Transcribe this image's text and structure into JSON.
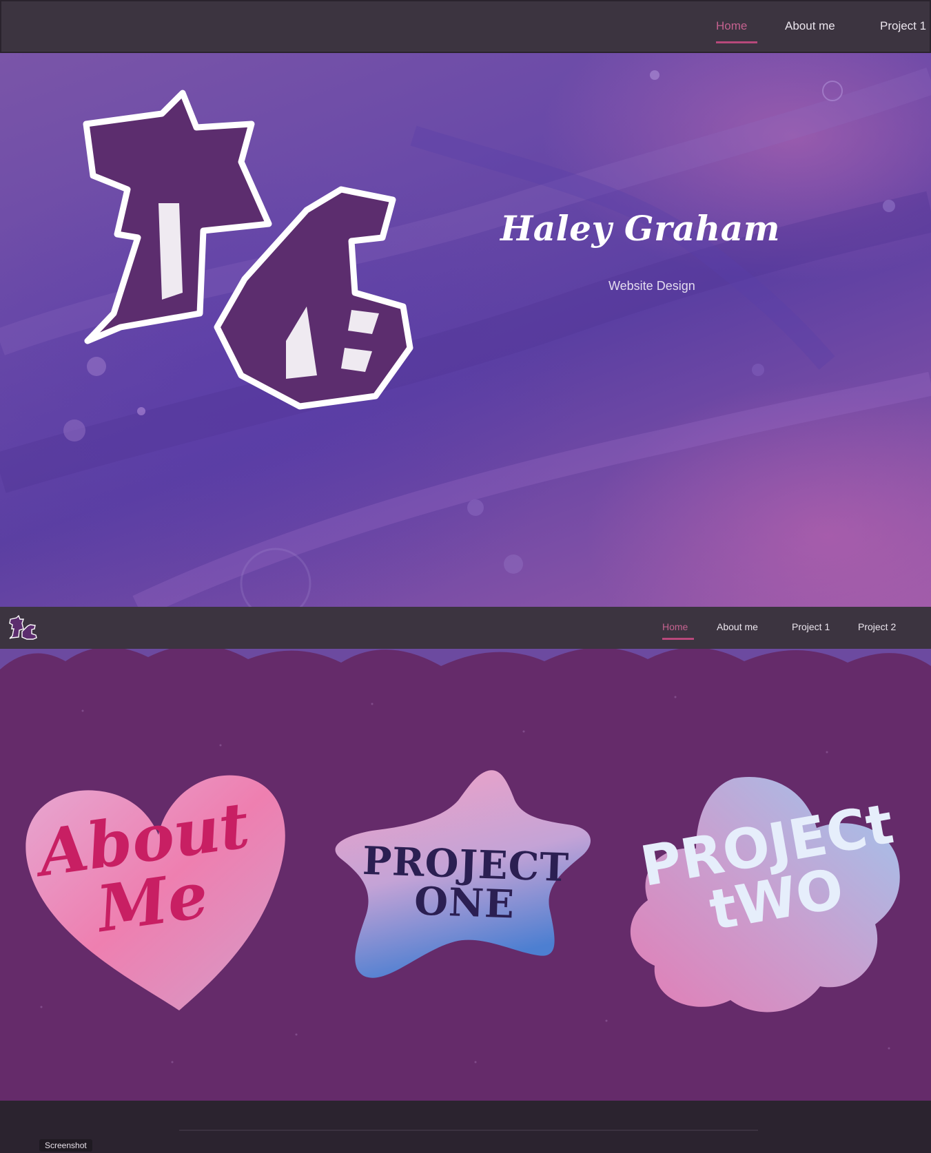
{
  "topnav": {
    "items": [
      {
        "label": "Home",
        "active": true
      },
      {
        "label": "About me",
        "active": false
      },
      {
        "label": "Project 1",
        "active": false
      }
    ]
  },
  "hero": {
    "title": "Haley Graham",
    "subtitle": "Website Design",
    "monogram": "HG"
  },
  "subnav": {
    "logo": "HG",
    "items": [
      {
        "label": "Home",
        "active": true
      },
      {
        "label": "About me",
        "active": false
      },
      {
        "label": "Project 1",
        "active": false
      },
      {
        "label": "Project 2",
        "active": false
      }
    ]
  },
  "stickers": {
    "about": {
      "line1": "About",
      "line2": "Me"
    },
    "project_one": {
      "line1": "PROJECT",
      "line2": "ONE"
    },
    "project_two": {
      "line1": "PROJECt",
      "line2": "tWO"
    }
  },
  "footer": {
    "label": "Screenshot"
  },
  "colors": {
    "nav_bg": "#3c3440",
    "accent": "#c4628f",
    "section_bg": "#652b6a",
    "heart_text": "#c81f63",
    "star_text": "#2b1f52",
    "cloud_text": "#e6eefb"
  }
}
